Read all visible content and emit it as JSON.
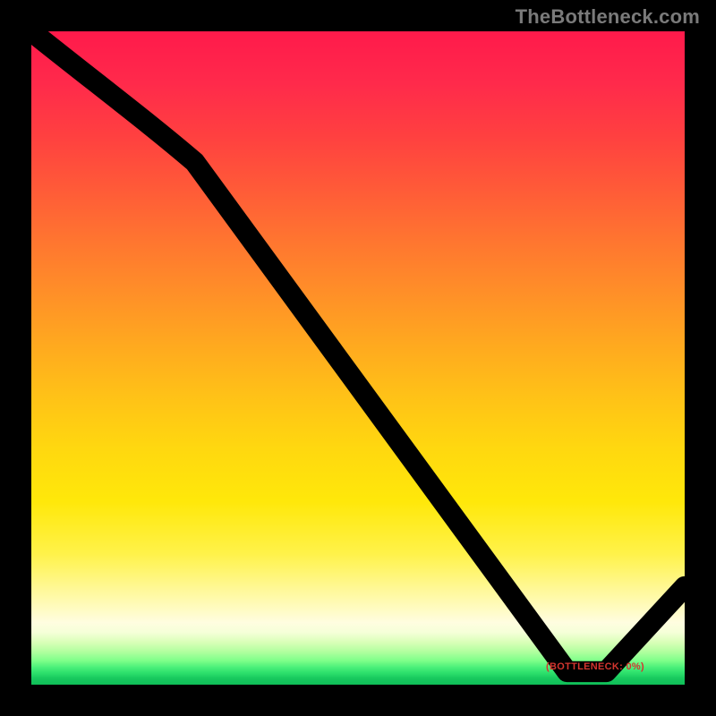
{
  "watermark": "TheBottleneck.com",
  "baseline_label": "(BOTTLENECK: 0%)",
  "colors": {
    "frame": "#000000",
    "watermark": "#7a7a7a",
    "baseline_label": "#d4352f",
    "curve": "#000000",
    "gradient_top": "#ff1a4b",
    "gradient_bottom": "#0fbf58"
  },
  "chart_data": {
    "type": "line",
    "title": "",
    "xlabel": "",
    "ylabel": "",
    "xlim": [
      0,
      100
    ],
    "ylim": [
      0,
      100
    ],
    "x": [
      0,
      25,
      82,
      88,
      100
    ],
    "values": [
      100,
      80,
      2,
      2,
      15
    ],
    "annotations": [
      {
        "text": "(BOTTLENECK: 0%)",
        "x": 85,
        "y": 2
      }
    ],
    "background": "vertical-gradient red→yellow→green (bottleneck heatmap)"
  }
}
